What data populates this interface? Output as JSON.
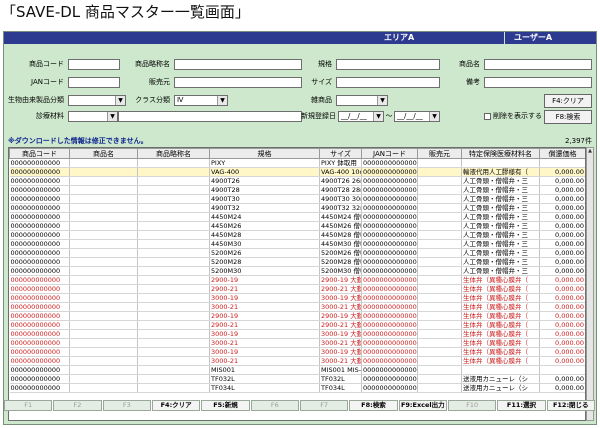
{
  "page_heading": "「SAVE-DL 商品マスター一覧画面」",
  "topbar": {
    "area_label": "エリアA",
    "user_label": "ユーザーA"
  },
  "form": {
    "product_code_label": "商品コード",
    "product_code_value": "",
    "product_abbr_label": "商品略称名",
    "product_abbr_value": "",
    "spec_label": "規格",
    "spec_value": "",
    "product_name_label": "商品名",
    "product_name_value": "",
    "jan_label": "JANコード",
    "jan_value": "",
    "seller_label": "販売元",
    "seller_value": "",
    "size_label": "サイズ",
    "size_value": "",
    "remarks_label": "備考",
    "remarks_value": "",
    "bio_label": "生物由来製品分類",
    "bio_value": "",
    "class_label": "クラス分類",
    "class_value": "Ⅳ",
    "misc_label": "雑商品",
    "misc_value": "",
    "f4_button": "F4:クリア",
    "material_label": "診療材料",
    "material_value": "",
    "date_label": "新規登録日",
    "date_from": "__/__/__",
    "date_sep": "～",
    "date_to": "__/__/__",
    "show_deleted_label": "削除を表示する",
    "f8_button": "F8:検索"
  },
  "notice": "※ダウンロードした情報は修正できません。",
  "record_count": "2,397件",
  "table": {
    "headers": [
      "商品コード",
      "商品名",
      "商品略称名",
      "規格",
      "サイズ",
      "JANコード",
      "販売元",
      "特定保険医療材料名",
      "償還価格"
    ],
    "rows": [
      {
        "code": "000000000000",
        "name": "",
        "abbr": "",
        "spec": "PIXY",
        "size": "PIXY 鉢取用",
        "jan": "0000000000000",
        "seller": "",
        "tokutei": "",
        "price": "",
        "style": "normal"
      },
      {
        "code": "000000000000",
        "name": "",
        "abbr": "",
        "spec": "VAG-400",
        "size": "VAG-400 10cm",
        "jan": "0000000000000",
        "seller": "",
        "tokutei": "輸液代用人工膠様有（",
        "price": "0,000.00",
        "style": "hl"
      },
      {
        "code": "000000000000",
        "name": "",
        "abbr": "",
        "spec": "4900T26",
        "size": "4900T26 26mm",
        "jan": "0000000000000",
        "seller": "",
        "tokutei": "人工骨頭・僧帽弁・三",
        "price": "0,000.00",
        "style": "normal"
      },
      {
        "code": "000000000000",
        "name": "",
        "abbr": "",
        "spec": "4900T28",
        "size": "4900T28 28mm",
        "jan": "0000000000000",
        "seller": "",
        "tokutei": "人工骨頭・僧帽弁・三",
        "price": "0,000.00",
        "style": "normal"
      },
      {
        "code": "000000000000",
        "name": "",
        "abbr": "",
        "spec": "4900T30",
        "size": "4900T30 30mm",
        "jan": "0000000000000",
        "seller": "",
        "tokutei": "人工骨頭・僧帽弁・三",
        "price": "0,000.00",
        "style": "normal"
      },
      {
        "code": "000000000000",
        "name": "",
        "abbr": "",
        "spec": "4900T32",
        "size": "4900T32 32mm",
        "jan": "0000000000000",
        "seller": "",
        "tokutei": "人工骨頭・僧帽弁・三",
        "price": "0,000.00",
        "style": "normal"
      },
      {
        "code": "000000000000",
        "name": "",
        "abbr": "",
        "spec": "4450M24",
        "size": "4450M24 僧帽",
        "jan": "0000000000000",
        "seller": "",
        "tokutei": "人工骨頭・僧帽弁・三",
        "price": "0,000.00",
        "style": "normal"
      },
      {
        "code": "000000000000",
        "name": "",
        "abbr": "",
        "spec": "4450M26",
        "size": "4450M26 僧帽",
        "jan": "0000000000000",
        "seller": "",
        "tokutei": "人工骨頭・僧帽弁・三",
        "price": "0,000.00",
        "style": "normal"
      },
      {
        "code": "000000000000",
        "name": "",
        "abbr": "",
        "spec": "4450M28",
        "size": "4450M28 僧帽",
        "jan": "0000000000000",
        "seller": "",
        "tokutei": "人工骨頭・僧帽弁・三",
        "price": "0,000.00",
        "style": "normal"
      },
      {
        "code": "000000000000",
        "name": "",
        "abbr": "",
        "spec": "4450M30",
        "size": "4450M30 僧帽",
        "jan": "0000000000000",
        "seller": "",
        "tokutei": "人工骨頭・僧帽弁・三",
        "price": "0,000.00",
        "style": "normal"
      },
      {
        "code": "000000000000",
        "name": "",
        "abbr": "",
        "spec": "5200M26",
        "size": "5200M26 僧帽",
        "jan": "0000000000000",
        "seller": "",
        "tokutei": "人工骨頭・僧帽弁・三",
        "price": "0,000.00",
        "style": "normal"
      },
      {
        "code": "000000000000",
        "name": "",
        "abbr": "",
        "spec": "5200M28",
        "size": "5200M28 僧帽",
        "jan": "0000000000000",
        "seller": "",
        "tokutei": "人工骨頭・僧帽弁・三",
        "price": "0,000.00",
        "style": "normal"
      },
      {
        "code": "000000000000",
        "name": "",
        "abbr": "",
        "spec": "5200M30",
        "size": "5200M30 僧帽",
        "jan": "0000000000000",
        "seller": "",
        "tokutei": "人工骨頭・僧帽弁・三",
        "price": "0,000.00",
        "style": "normal"
      },
      {
        "code": "000000000000",
        "name": "",
        "abbr": "",
        "spec": "2900-19",
        "size": "2900-19 大動",
        "jan": "0000000000000",
        "seller": "",
        "tokutei": "生体弁（異種心膜弁（",
        "price": "0,000.00",
        "style": "red"
      },
      {
        "code": "000000000000",
        "name": "",
        "abbr": "",
        "spec": "2900-21",
        "size": "2900-21 大動",
        "jan": "0000000000000",
        "seller": "",
        "tokutei": "生体弁（異種心膜弁（",
        "price": "0,000.00",
        "style": "red"
      },
      {
        "code": "000000000000",
        "name": "",
        "abbr": "",
        "spec": "3000-19",
        "size": "3000-19 大動",
        "jan": "0000000000000",
        "seller": "",
        "tokutei": "生体弁（異種心膜弁（",
        "price": "0,000.00",
        "style": "red"
      },
      {
        "code": "000000000000",
        "name": "",
        "abbr": "",
        "spec": "3000-21",
        "size": "3000-21 大動",
        "jan": "0000000000000",
        "seller": "",
        "tokutei": "生体弁（異種心膜弁（",
        "price": "0,000.00",
        "style": "red"
      },
      {
        "code": "000000000000",
        "name": "",
        "abbr": "",
        "spec": "2900-19",
        "size": "2900-19 大動",
        "jan": "0000000000000",
        "seller": "",
        "tokutei": "生体弁（異種心膜弁（",
        "price": "0,000.00",
        "style": "red"
      },
      {
        "code": "000000000000",
        "name": "",
        "abbr": "",
        "spec": "2900-21",
        "size": "2900-21 大動",
        "jan": "0000000000000",
        "seller": "",
        "tokutei": "生体弁（異種心膜弁（",
        "price": "0,000.00",
        "style": "red"
      },
      {
        "code": "000000000000",
        "name": "",
        "abbr": "",
        "spec": "3000-19",
        "size": "3000-19 大動",
        "jan": "0000000000000",
        "seller": "",
        "tokutei": "生体弁（異種心膜弁（",
        "price": "0,000.00",
        "style": "red"
      },
      {
        "code": "000000000000",
        "name": "",
        "abbr": "",
        "spec": "3000-21",
        "size": "3000-21 大動",
        "jan": "0000000000000",
        "seller": "",
        "tokutei": "生体弁（異種心膜弁（",
        "price": "0,000.00",
        "style": "red"
      },
      {
        "code": "000000000000",
        "name": "",
        "abbr": "",
        "spec": "3000-19",
        "size": "3000-19 大動",
        "jan": "0000000000000",
        "seller": "",
        "tokutei": "生体弁（異種心膜弁（",
        "price": "0,000.00",
        "style": "red"
      },
      {
        "code": "000000000000",
        "name": "",
        "abbr": "",
        "spec": "3000-21",
        "size": "3000-21 大動",
        "jan": "0000000000000",
        "seller": "",
        "tokutei": "生体弁（異種心膜弁（",
        "price": "0,000.00",
        "style": "red"
      },
      {
        "code": "000000000000",
        "name": "",
        "abbr": "",
        "spec": "MIS001",
        "size": "MIS001 MIS-9",
        "jan": "0000000000000",
        "seller": "",
        "tokutei": "",
        "price": "",
        "style": "normal"
      },
      {
        "code": "000000000000",
        "name": "",
        "abbr": "",
        "spec": "TF032L",
        "size": "TF032L",
        "jan": "0000000000000",
        "seller": "",
        "tokutei": "送液用カニューレ（シ",
        "price": "0,000.00",
        "style": "normal"
      },
      {
        "code": "000000000000",
        "name": "",
        "abbr": "",
        "spec": "TF034L",
        "size": "TF034L",
        "jan": "0000000000000",
        "seller": "",
        "tokutei": "送液用カニューレ（シ",
        "price": "0,000.00",
        "style": "normal"
      }
    ]
  },
  "fkeys": [
    {
      "label": "F1",
      "enabled": false,
      "name": "fkey-f1"
    },
    {
      "label": "F2",
      "enabled": false,
      "name": "fkey-f2"
    },
    {
      "label": "F3",
      "enabled": false,
      "name": "fkey-f3"
    },
    {
      "label": "F4:クリア",
      "enabled": true,
      "name": "fkey-f4-clear"
    },
    {
      "label": "F5:新規",
      "enabled": true,
      "name": "fkey-f5-new"
    },
    {
      "label": "F6",
      "enabled": false,
      "name": "fkey-f6"
    },
    {
      "label": "F7",
      "enabled": false,
      "name": "fkey-f7"
    },
    {
      "label": "F8:検索",
      "enabled": true,
      "name": "fkey-f8-search"
    },
    {
      "label": "F9:Excel出力",
      "enabled": true,
      "name": "fkey-f9-excel"
    },
    {
      "label": "F10",
      "enabled": false,
      "name": "fkey-f10"
    },
    {
      "label": "F11:選択",
      "enabled": true,
      "name": "fkey-f11-select"
    },
    {
      "label": "F12:閉じる",
      "enabled": true,
      "name": "fkey-f12-close"
    }
  ],
  "colors": {
    "title_bar": "#2c3a8f",
    "panel_bg": "#cde8cc",
    "notice": "#0b1f8f",
    "alert_row": "#cc1b1b",
    "highlight_row": "#fff7c8"
  }
}
